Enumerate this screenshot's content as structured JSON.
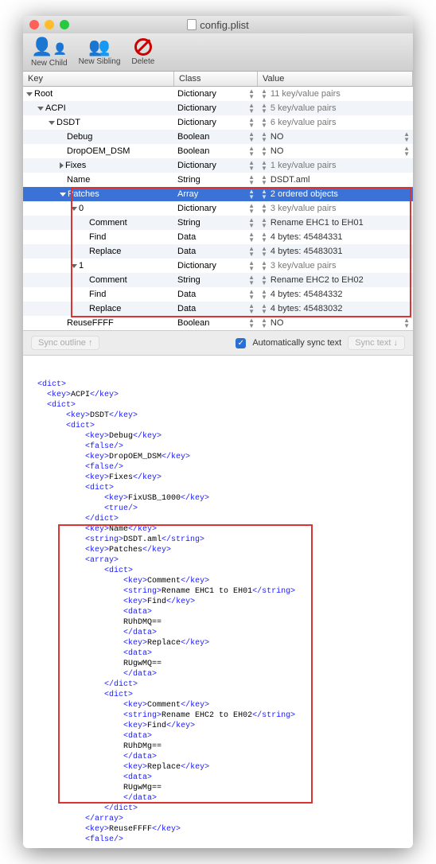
{
  "window": {
    "title": "config.plist"
  },
  "toolbar": {
    "new_child": "New Child",
    "new_sibling": "New Sibling",
    "delete": "Delete"
  },
  "columns": {
    "key": "Key",
    "class": "Class",
    "value": "Value"
  },
  "rows": [
    {
      "indent": 0,
      "arrow": "down",
      "key": "Root",
      "class": "Dictionary",
      "value": "11 key/value pairs"
    },
    {
      "indent": 1,
      "arrow": "down",
      "key": "ACPI",
      "class": "Dictionary",
      "value": "5 key/value pairs"
    },
    {
      "indent": 2,
      "arrow": "down",
      "key": "DSDT",
      "class": "Dictionary",
      "value": "6 key/value pairs"
    },
    {
      "indent": 3,
      "arrow": "",
      "key": "Debug",
      "class": "Boolean",
      "value": "NO",
      "vstep": true
    },
    {
      "indent": 3,
      "arrow": "",
      "key": "DropOEM_DSM",
      "class": "Boolean",
      "value": "NO",
      "vstep": true
    },
    {
      "indent": 3,
      "arrow": "right",
      "key": "Fixes",
      "class": "Dictionary",
      "value": "1 key/value pairs"
    },
    {
      "indent": 3,
      "arrow": "",
      "key": "Name",
      "class": "String",
      "value": "DSDT.aml"
    },
    {
      "indent": 3,
      "arrow": "down",
      "key": "Patches",
      "class": "Array",
      "value": "2 ordered objects",
      "selected": true
    },
    {
      "indent": 4,
      "arrow": "down",
      "key": "0",
      "class": "Dictionary",
      "value": "3 key/value pairs"
    },
    {
      "indent": 5,
      "arrow": "",
      "key": "Comment",
      "class": "String",
      "value": "Rename EHC1 to EH01"
    },
    {
      "indent": 5,
      "arrow": "",
      "key": "Find",
      "class": "Data",
      "value": "4 bytes: 45484331"
    },
    {
      "indent": 5,
      "arrow": "",
      "key": "Replace",
      "class": "Data",
      "value": "4 bytes: 45483031"
    },
    {
      "indent": 4,
      "arrow": "down",
      "key": "1",
      "class": "Dictionary",
      "value": "3 key/value pairs"
    },
    {
      "indent": 5,
      "arrow": "",
      "key": "Comment",
      "class": "String",
      "value": "Rename EHC2 to EH02"
    },
    {
      "indent": 5,
      "arrow": "",
      "key": "Find",
      "class": "Data",
      "value": "4 bytes: 45484332"
    },
    {
      "indent": 5,
      "arrow": "",
      "key": "Replace",
      "class": "Data",
      "value": "4 bytes: 45483032"
    },
    {
      "indent": 3,
      "arrow": "",
      "key": "ReuseFFFF",
      "class": "Boolean",
      "value": "NO",
      "vstep": true
    }
  ],
  "syncbar": {
    "sync_outline": "Sync outline ↑",
    "auto_label": "Automatically sync text",
    "sync_text": "Sync text ↓"
  },
  "xml_lines": [
    {
      "i": 0,
      "p": [
        {
          "t": "t",
          "v": "<dict>"
        }
      ]
    },
    {
      "i": 1,
      "p": [
        {
          "t": "t",
          "v": "<key>"
        },
        {
          "t": "v",
          "v": "ACPI"
        },
        {
          "t": "t",
          "v": "</key>"
        }
      ]
    },
    {
      "i": 1,
      "p": [
        {
          "t": "t",
          "v": "<dict>"
        }
      ]
    },
    {
      "i": 2,
      "p": [
        {
          "t": "t",
          "v": "<key>"
        },
        {
          "t": "v",
          "v": "DSDT"
        },
        {
          "t": "t",
          "v": "</key>"
        }
      ]
    },
    {
      "i": 2,
      "p": [
        {
          "t": "t",
          "v": "<dict>"
        }
      ]
    },
    {
      "i": 3,
      "p": [
        {
          "t": "t",
          "v": "<key>"
        },
        {
          "t": "v",
          "v": "Debug"
        },
        {
          "t": "t",
          "v": "</key>"
        }
      ]
    },
    {
      "i": 3,
      "p": [
        {
          "t": "t",
          "v": "<false/>"
        }
      ]
    },
    {
      "i": 3,
      "p": [
        {
          "t": "t",
          "v": "<key>"
        },
        {
          "t": "v",
          "v": "DropOEM_DSM"
        },
        {
          "t": "t",
          "v": "</key>"
        }
      ]
    },
    {
      "i": 3,
      "p": [
        {
          "t": "t",
          "v": "<false/>"
        }
      ]
    },
    {
      "i": 3,
      "p": [
        {
          "t": "t",
          "v": "<key>"
        },
        {
          "t": "v",
          "v": "Fixes"
        },
        {
          "t": "t",
          "v": "</key>"
        }
      ]
    },
    {
      "i": 3,
      "p": [
        {
          "t": "t",
          "v": "<dict>"
        }
      ]
    },
    {
      "i": 4,
      "p": [
        {
          "t": "t",
          "v": "<key>"
        },
        {
          "t": "v",
          "v": "FixUSB_1000"
        },
        {
          "t": "t",
          "v": "</key>"
        }
      ]
    },
    {
      "i": 4,
      "p": [
        {
          "t": "t",
          "v": "<true/>"
        }
      ]
    },
    {
      "i": 3,
      "p": [
        {
          "t": "t",
          "v": "</dict>"
        }
      ]
    },
    {
      "i": 3,
      "p": [
        {
          "t": "t",
          "v": "<key>"
        },
        {
          "t": "v",
          "v": "Name"
        },
        {
          "t": "t",
          "v": "</key>"
        }
      ]
    },
    {
      "i": 3,
      "p": [
        {
          "t": "t",
          "v": "<string>"
        },
        {
          "t": "v",
          "v": "DSDT.aml"
        },
        {
          "t": "t",
          "v": "</string>"
        }
      ]
    },
    {
      "i": 3,
      "p": [
        {
          "t": "t",
          "v": "<key>"
        },
        {
          "t": "v",
          "v": "Patches"
        },
        {
          "t": "t",
          "v": "</key>"
        }
      ]
    },
    {
      "i": 3,
      "p": [
        {
          "t": "t",
          "v": "<array>"
        }
      ]
    },
    {
      "i": 4,
      "p": [
        {
          "t": "t",
          "v": "<dict>"
        }
      ]
    },
    {
      "i": 5,
      "p": [
        {
          "t": "t",
          "v": "<key>"
        },
        {
          "t": "v",
          "v": "Comment"
        },
        {
          "t": "t",
          "v": "</key>"
        }
      ]
    },
    {
      "i": 5,
      "p": [
        {
          "t": "t",
          "v": "<string>"
        },
        {
          "t": "v",
          "v": "Rename EHC1 to EH01"
        },
        {
          "t": "t",
          "v": "</string>"
        }
      ]
    },
    {
      "i": 5,
      "p": [
        {
          "t": "t",
          "v": "<key>"
        },
        {
          "t": "v",
          "v": "Find"
        },
        {
          "t": "t",
          "v": "</key>"
        }
      ]
    },
    {
      "i": 5,
      "p": [
        {
          "t": "t",
          "v": "<data>"
        }
      ]
    },
    {
      "i": 5,
      "p": [
        {
          "t": "v",
          "v": "RUhDMQ=="
        }
      ]
    },
    {
      "i": 5,
      "p": [
        {
          "t": "t",
          "v": "</data>"
        }
      ]
    },
    {
      "i": 5,
      "p": [
        {
          "t": "t",
          "v": "<key>"
        },
        {
          "t": "v",
          "v": "Replace"
        },
        {
          "t": "t",
          "v": "</key>"
        }
      ]
    },
    {
      "i": 5,
      "p": [
        {
          "t": "t",
          "v": "<data>"
        }
      ]
    },
    {
      "i": 5,
      "p": [
        {
          "t": "v",
          "v": "RUgwMQ=="
        }
      ]
    },
    {
      "i": 5,
      "p": [
        {
          "t": "t",
          "v": "</data>"
        }
      ]
    },
    {
      "i": 4,
      "p": [
        {
          "t": "t",
          "v": "</dict>"
        }
      ]
    },
    {
      "i": 4,
      "p": [
        {
          "t": "t",
          "v": "<dict>"
        }
      ]
    },
    {
      "i": 5,
      "p": [
        {
          "t": "t",
          "v": "<key>"
        },
        {
          "t": "v",
          "v": "Comment"
        },
        {
          "t": "t",
          "v": "</key>"
        }
      ]
    },
    {
      "i": 5,
      "p": [
        {
          "t": "t",
          "v": "<string>"
        },
        {
          "t": "v",
          "v": "Rename EHC2 to EH02"
        },
        {
          "t": "t",
          "v": "</string>"
        }
      ]
    },
    {
      "i": 5,
      "p": [
        {
          "t": "t",
          "v": "<key>"
        },
        {
          "t": "v",
          "v": "Find"
        },
        {
          "t": "t",
          "v": "</key>"
        }
      ]
    },
    {
      "i": 5,
      "p": [
        {
          "t": "t",
          "v": "<data>"
        }
      ]
    },
    {
      "i": 5,
      "p": [
        {
          "t": "v",
          "v": "RUhDMg=="
        }
      ]
    },
    {
      "i": 5,
      "p": [
        {
          "t": "t",
          "v": "</data>"
        }
      ]
    },
    {
      "i": 5,
      "p": [
        {
          "t": "t",
          "v": "<key>"
        },
        {
          "t": "v",
          "v": "Replace"
        },
        {
          "t": "t",
          "v": "</key>"
        }
      ]
    },
    {
      "i": 5,
      "p": [
        {
          "t": "t",
          "v": "<data>"
        }
      ]
    },
    {
      "i": 5,
      "p": [
        {
          "t": "v",
          "v": "RUgwMg=="
        }
      ]
    },
    {
      "i": 5,
      "p": [
        {
          "t": "t",
          "v": "</data>"
        }
      ]
    },
    {
      "i": 4,
      "p": [
        {
          "t": "t",
          "v": "</dict>"
        }
      ]
    },
    {
      "i": 3,
      "p": [
        {
          "t": "t",
          "v": "</array>"
        }
      ]
    },
    {
      "i": 3,
      "p": [
        {
          "t": "t",
          "v": "<key>"
        },
        {
          "t": "v",
          "v": "ReuseFFFF"
        },
        {
          "t": "t",
          "v": "</key>"
        }
      ]
    },
    {
      "i": 3,
      "p": [
        {
          "t": "t",
          "v": "<false/>"
        }
      ]
    }
  ]
}
